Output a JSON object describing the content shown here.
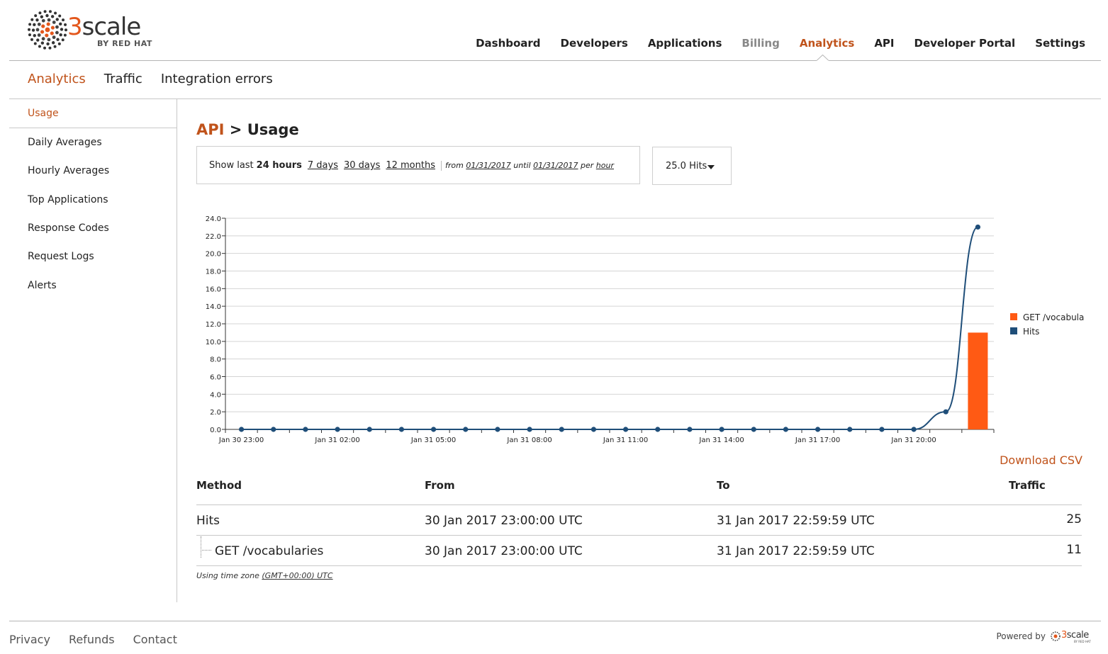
{
  "brand": {
    "logo_text": "3scale",
    "logo_sub": "BY RED HAT",
    "accent": "#c0531b",
    "logo_orange": "#e3571c"
  },
  "topnav": {
    "items": [
      {
        "label": "Dashboard",
        "state": "normal"
      },
      {
        "label": "Developers",
        "state": "normal"
      },
      {
        "label": "Applications",
        "state": "normal"
      },
      {
        "label": "Billing",
        "state": "muted"
      },
      {
        "label": "Analytics",
        "state": "active"
      },
      {
        "label": "API",
        "state": "normal"
      },
      {
        "label": "Developer Portal",
        "state": "normal"
      },
      {
        "label": "Settings",
        "state": "normal"
      }
    ]
  },
  "subnav": {
    "items": [
      "Analytics",
      "Traffic",
      "Integration errors"
    ],
    "active": "Analytics"
  },
  "sidebar": {
    "items": [
      "Usage",
      "Daily Averages",
      "Hourly Averages",
      "Top Applications",
      "Response Codes",
      "Request Logs",
      "Alerts"
    ],
    "active": "Usage"
  },
  "page": {
    "title_api": "API",
    "title_rest": "> Usage"
  },
  "range": {
    "show_last": "Show last",
    "current": "24 hours",
    "options": [
      "7 days",
      "30 days",
      "12 months"
    ],
    "from_label": "from",
    "from_date": "01/31/2017",
    "until_label": "until",
    "until_date": "01/31/2017",
    "per_label": "per",
    "per_value": "hour"
  },
  "hits_dropdown": {
    "label": "25.0 Hits"
  },
  "chart_data": {
    "type": "bar+line",
    "x_tick_labels": [
      "Jan 30 23:00",
      "Jan 31 02:00",
      "Jan 31 05:00",
      "Jan 31 08:00",
      "Jan 31 11:00",
      "Jan 31 14:00",
      "Jan 31 17:00",
      "Jan 31 20:00"
    ],
    "x_hours": [
      "Jan 30 23:00",
      "Jan 31 00:00",
      "Jan 31 01:00",
      "Jan 31 02:00",
      "Jan 31 03:00",
      "Jan 31 04:00",
      "Jan 31 05:00",
      "Jan 31 06:00",
      "Jan 31 07:00",
      "Jan 31 08:00",
      "Jan 31 09:00",
      "Jan 31 10:00",
      "Jan 31 11:00",
      "Jan 31 12:00",
      "Jan 31 13:00",
      "Jan 31 14:00",
      "Jan 31 15:00",
      "Jan 31 16:00",
      "Jan 31 17:00",
      "Jan 31 18:00",
      "Jan 31 19:00",
      "Jan 31 20:00",
      "Jan 31 21:00",
      "Jan 31 22:00"
    ],
    "ylim": [
      0,
      24
    ],
    "y_ticks": [
      "0.0",
      "2.0",
      "4.0",
      "6.0",
      "8.0",
      "10.0",
      "12.0",
      "14.0",
      "16.0",
      "18.0",
      "20.0",
      "22.0",
      "24.0"
    ],
    "series": [
      {
        "name": "GET /vocabularies",
        "kind": "bar",
        "color": "#ff5a14",
        "values": [
          0,
          0,
          0,
          0,
          0,
          0,
          0,
          0,
          0,
          0,
          0,
          0,
          0,
          0,
          0,
          0,
          0,
          0,
          0,
          0,
          0,
          0,
          0,
          11
        ]
      },
      {
        "name": "Hits",
        "kind": "line",
        "color": "#1f4e79",
        "values": [
          0,
          0,
          0,
          0,
          0,
          0,
          0,
          0,
          0,
          0,
          0,
          0,
          0,
          0,
          0,
          0,
          0,
          0,
          0,
          0,
          0,
          0,
          2,
          23
        ]
      }
    ],
    "legend_position": "right",
    "grid": true
  },
  "download_csv": "Download CSV",
  "table": {
    "headers": [
      "Method",
      "From",
      "To",
      "Traffic"
    ],
    "rows": [
      {
        "method": "Hits",
        "from": "30 Jan 2017 23:00:00 UTC",
        "to": "31 Jan 2017 22:59:59 UTC",
        "traffic": "25"
      },
      {
        "method": "GET /vocabularies",
        "from": "30 Jan 2017 23:00:00 UTC",
        "to": "31 Jan 2017 22:59:59 UTC",
        "traffic": "11"
      }
    ]
  },
  "timezone": {
    "label": "Using time zone",
    "value": "(GMT+00:00) UTC"
  },
  "footer": {
    "links": [
      "Privacy",
      "Refunds",
      "Contact"
    ],
    "powered_by": "Powered by",
    "mini_logo_text": "3scale",
    "mini_logo_sub": "BY RED HAT"
  }
}
